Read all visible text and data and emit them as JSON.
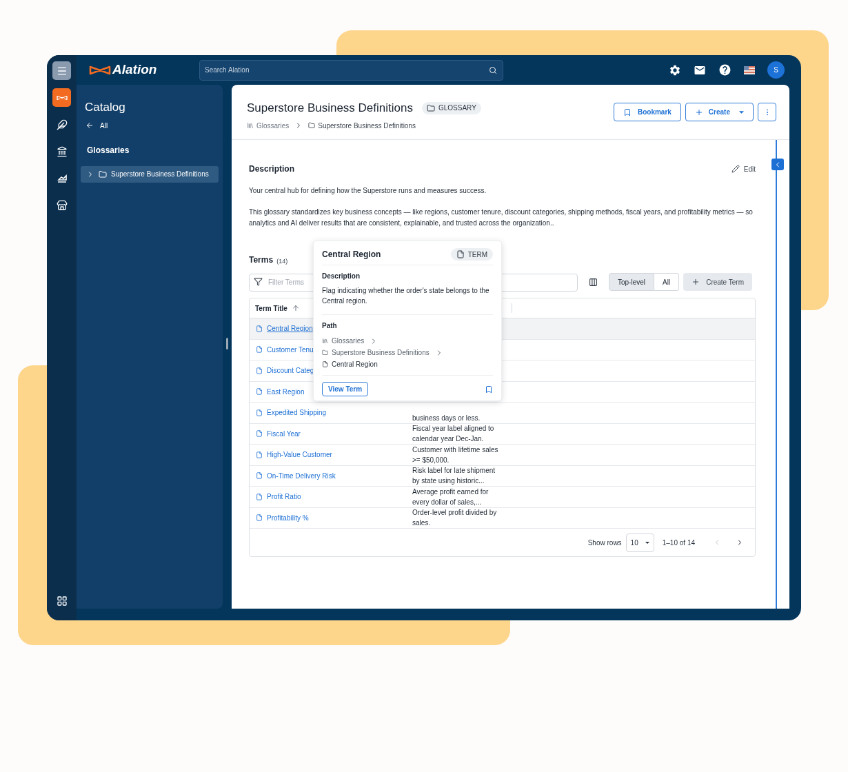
{
  "topbar": {
    "logo": "Alation",
    "search": {
      "placeholder": "Search Alation"
    },
    "avatar": "S"
  },
  "rail": {
    "items": [
      {
        "kind": "catalog",
        "selected": true
      },
      {
        "kind": "feather",
        "selected": false
      },
      {
        "kind": "bank",
        "selected": false
      },
      {
        "kind": "chart",
        "selected": false
      },
      {
        "kind": "store",
        "selected": false
      }
    ]
  },
  "sidebar": {
    "title": "Catalog",
    "back": "All",
    "section": "Glossaries",
    "items": [
      {
        "label": "Superstore Business Definitions",
        "selected": true,
        "expanded": false
      }
    ]
  },
  "page": {
    "title": "Superstore Business Definitions",
    "badge": "GLOSSARY",
    "breadcrumb": [
      {
        "kind": "glossaries",
        "label": "Glossaries"
      },
      {
        "kind": "folder",
        "label": "Superstore Business Definitions"
      }
    ],
    "bookmark": "Bookmark",
    "create": "Create"
  },
  "description": {
    "heading": "Description",
    "edit": "Edit",
    "paragraphs": [
      "Your central hub for defining how the Superstore runs and measures success.",
      "This glossary standardizes key business concepts — like regions, customer tenure, discount categories, shipping methods, fiscal years, and profitability metrics — so analytics and AI deliver results that are consistent, explainable, and trusted across the organization.."
    ]
  },
  "terms": {
    "heading": "Terms",
    "count": "(14)",
    "filter_placeholder": "Filter Terms",
    "scopes": [
      {
        "label": "Top-level",
        "selected": true
      },
      {
        "label": "All",
        "selected": false
      }
    ],
    "create": "Create Term",
    "column": {
      "label": "Term Title",
      "sort_ascending": true
    },
    "rows": [
      {
        "title": "Central Region",
        "highlighted": true
      },
      {
        "title": "Customer Tenu",
        "highlighted": false
      },
      {
        "title": "Discount Categ",
        "highlighted": false
      },
      {
        "title": "East Region",
        "highlighted": false
      },
      {
        "title": "Expedited Shipping",
        "highlighted": false,
        "description": [
          "business days or less."
        ]
      },
      {
        "title": "Fiscal Year",
        "highlighted": false,
        "description": [
          "Fiscal year label aligned to",
          "calendar year Dec-Jan."
        ]
      },
      {
        "title": "High-Value Customer",
        "highlighted": false,
        "description": [
          "Customer with lifetime sales",
          ">= $50,000."
        ]
      },
      {
        "title": "On-Time Delivery Risk",
        "highlighted": false,
        "description": [
          "Risk label for late shipment",
          "by state using historic..."
        ]
      },
      {
        "title": "Profit Ratio",
        "highlighted": false,
        "description": [
          "Average profit earned for",
          "every dollar of sales,..."
        ]
      },
      {
        "title": "Profitability %",
        "highlighted": false,
        "description": [
          "Order-level profit divided by",
          "sales."
        ]
      }
    ],
    "pagination": {
      "label": "Show rows",
      "rows_per_page": "10",
      "range": "1–10 of 14",
      "prev_disabled": true,
      "next_disabled": false
    }
  },
  "popover": {
    "title": "Central Region",
    "badge": "TERM",
    "description_heading": "Description",
    "description": "Flag indicating whether the order's state belongs to the Central region.",
    "path_heading": "Path",
    "path": [
      {
        "kind": "glossaries",
        "label": "Glossaries"
      },
      {
        "kind": "folder",
        "label": "Superstore Business Definitions"
      },
      {
        "kind": "term",
        "label": "Central Region"
      }
    ],
    "button": "View Term"
  }
}
